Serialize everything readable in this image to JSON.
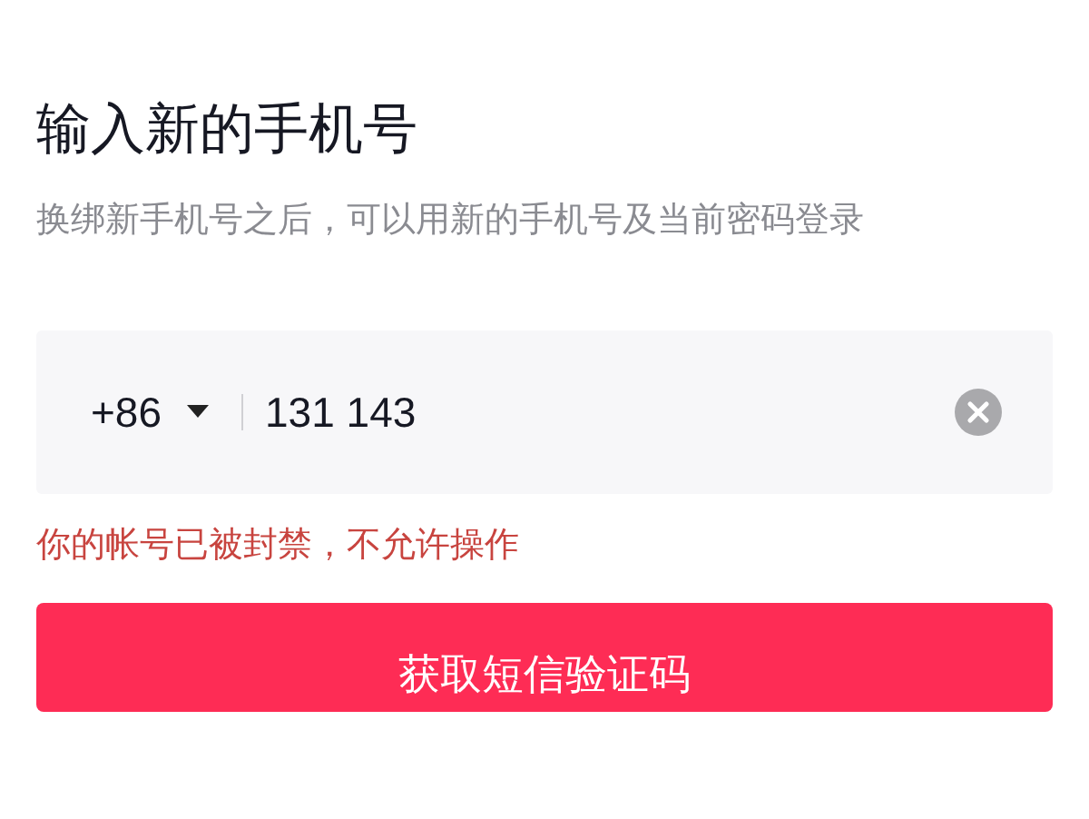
{
  "title": "输入新的手机号",
  "description": "换绑新手机号之后，可以用新的手机号及当前密码登录",
  "phone_field": {
    "country_code": "+86",
    "value": "131 143"
  },
  "error": "你的帐号已被封禁，不允许操作",
  "button": "获取短信验证码"
}
